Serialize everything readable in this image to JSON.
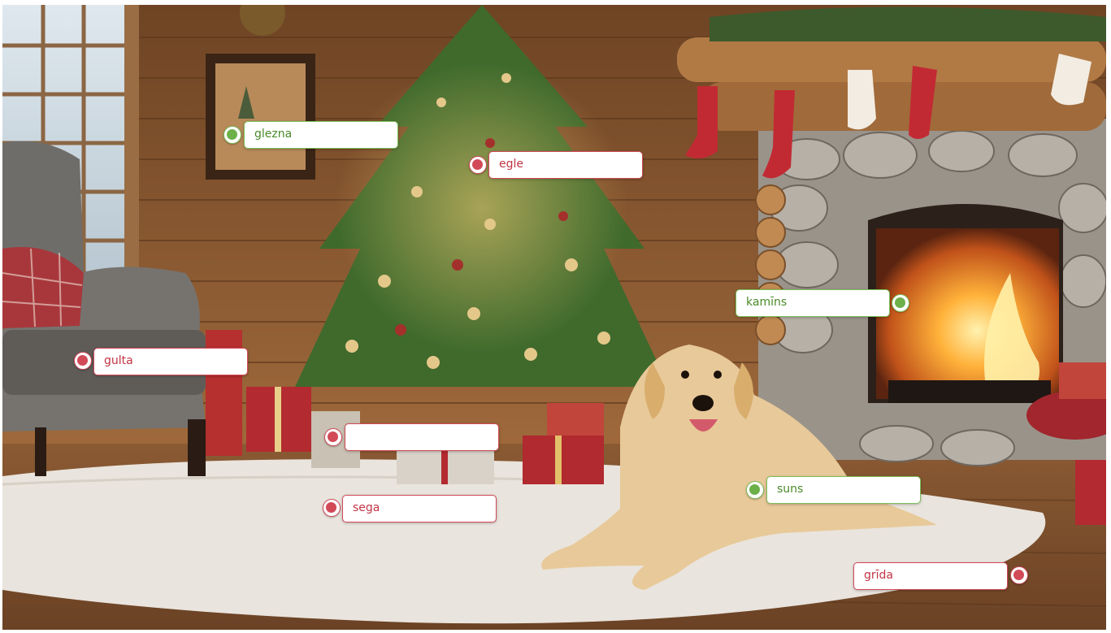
{
  "scene": {
    "colors": {
      "wall": "#8a5a34",
      "floor": "#7b4f2c",
      "rug": "#e9e4dd",
      "tree": "#3f6a2c",
      "fire": "#ffb640",
      "stone": "#9a938a",
      "dog": "#e8c999",
      "chair": "#6d6a66",
      "accent_red": "#b6242f",
      "correct_green": "#6cb04a",
      "incorrect_red": "#d24a58"
    }
  },
  "labels": [
    {
      "id": "glezna",
      "text": "glezna",
      "status": "correct"
    },
    {
      "id": "egle",
      "text": "egle",
      "status": "incorrect"
    },
    {
      "id": "kamins",
      "text": "kamīns",
      "status": "correct"
    },
    {
      "id": "gulta",
      "text": "gulta",
      "status": "incorrect"
    },
    {
      "id": "empty",
      "text": "",
      "status": "incorrect"
    },
    {
      "id": "sega",
      "text": "sega",
      "status": "incorrect"
    },
    {
      "id": "suns",
      "text": "suns",
      "status": "correct"
    },
    {
      "id": "grida",
      "text": "grīda",
      "status": "incorrect"
    }
  ]
}
